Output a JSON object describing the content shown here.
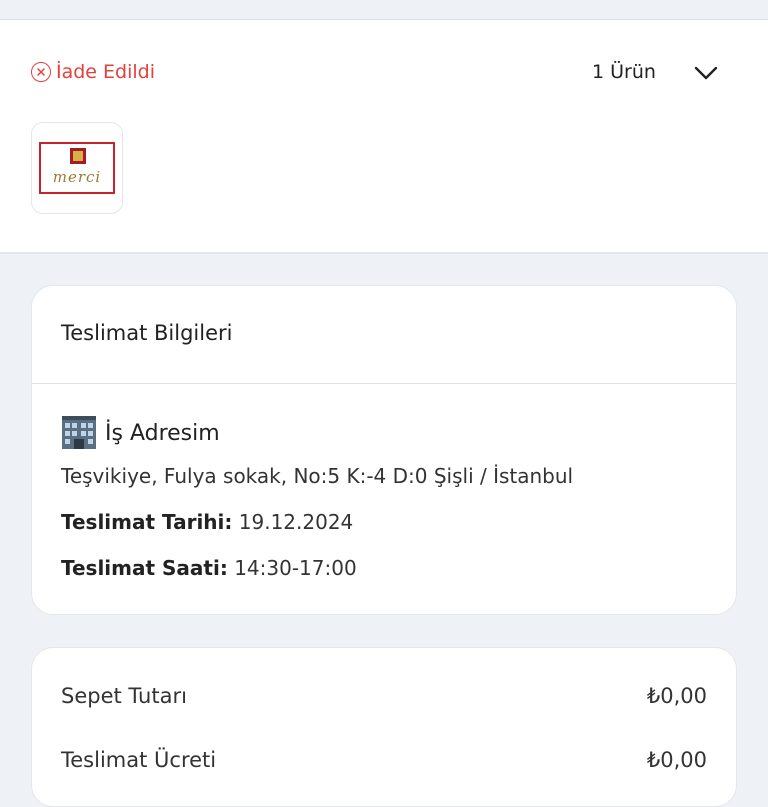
{
  "order": {
    "status": "İade Edildi",
    "status_color": "#e5403c",
    "item_count": "1 Ürün",
    "product_brand": "merci"
  },
  "delivery": {
    "title": "Teslimat Bilgileri",
    "address_name": "İş Adresim",
    "address_icon": "office-building-icon",
    "address_line": "Teşvikiye, Fulya sokak, No:5 K:-4 D:0 Şişli / İstanbul",
    "date_label": "Teslimat Tarihi:",
    "date_value": "19.12.2024",
    "time_label": "Teslimat Saati:",
    "time_value": "14:30-17:00"
  },
  "summary": {
    "basket_label": "Sepet Tutarı",
    "basket_value": "₺0,00",
    "fee_label": "Teslimat Ücreti",
    "fee_value": "₺0,00"
  }
}
